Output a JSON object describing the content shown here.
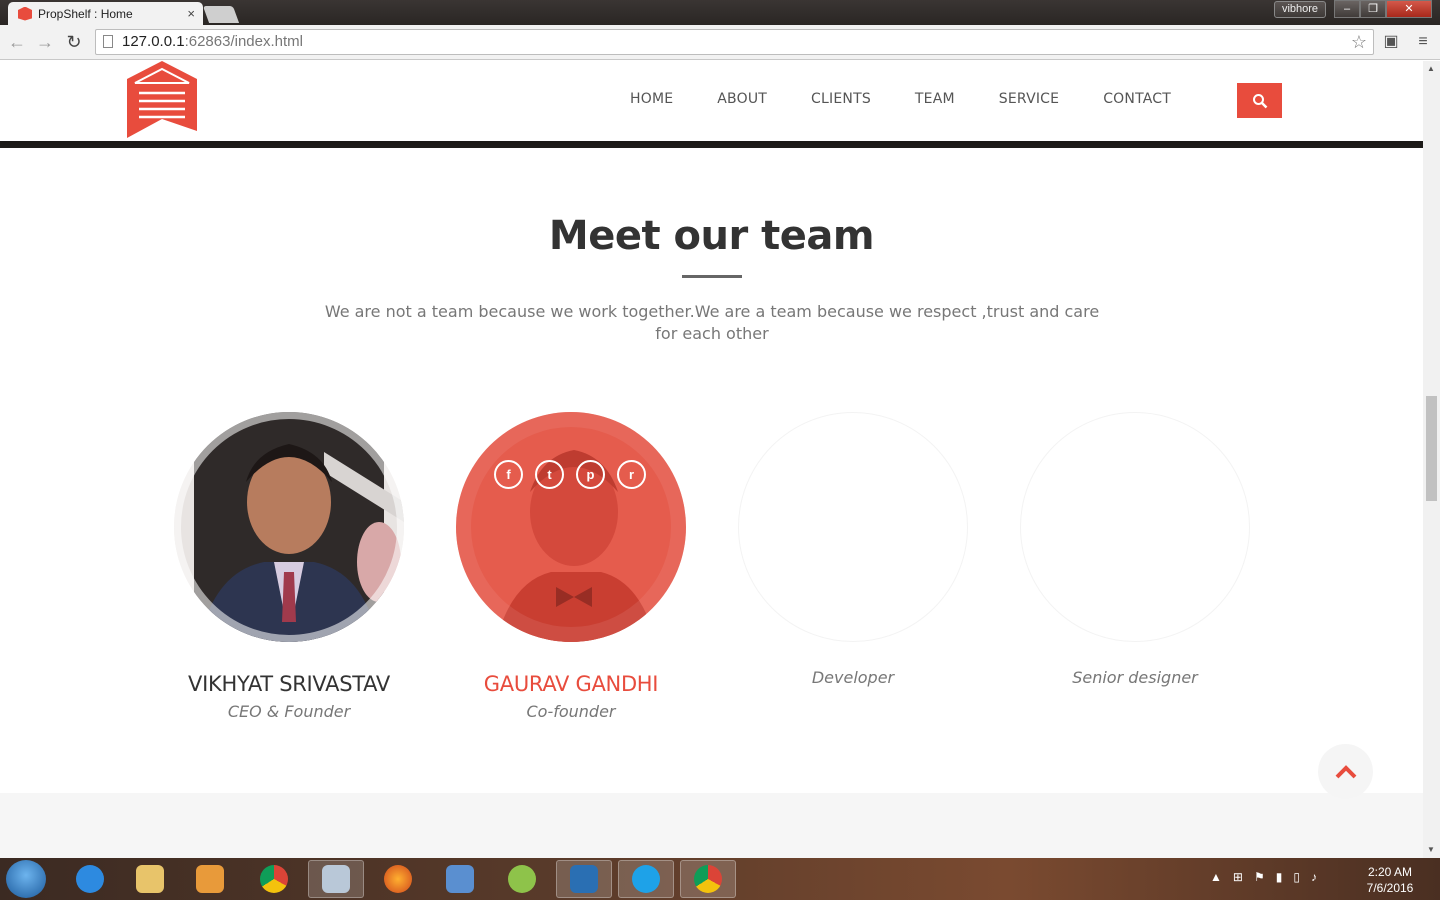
{
  "browser": {
    "tab_title": "PropShelf : Home",
    "tab_close": "×",
    "user_label": "vibhore",
    "url_host": "127.0.0.1",
    "url_path": ":62863/index.html"
  },
  "nav": {
    "items": [
      "HOME",
      "ABOUT",
      "CLIENTS",
      "TEAM",
      "SERVICE",
      "CONTACT"
    ]
  },
  "team": {
    "title": "Meet our team",
    "subtitle": "We are not a team because we work together.We are a team because we respect ,trust and care for each other",
    "members": [
      {
        "name": "VIKHYAT SRIVASTAV",
        "role": "CEO & Founder"
      },
      {
        "name": "GAURAV GANDHI",
        "role": "Co-founder"
      },
      {
        "name": "",
        "role": "Developer"
      },
      {
        "name": "",
        "role": "Senior designer"
      }
    ],
    "social_icons": [
      "f",
      "t",
      "p",
      "r"
    ]
  },
  "taskbar": {
    "time": "2:20 AM",
    "date": "7/6/2016"
  },
  "colors": {
    "accent": "#e84c3d",
    "text_dark": "#333333",
    "text_muted": "#777777"
  }
}
